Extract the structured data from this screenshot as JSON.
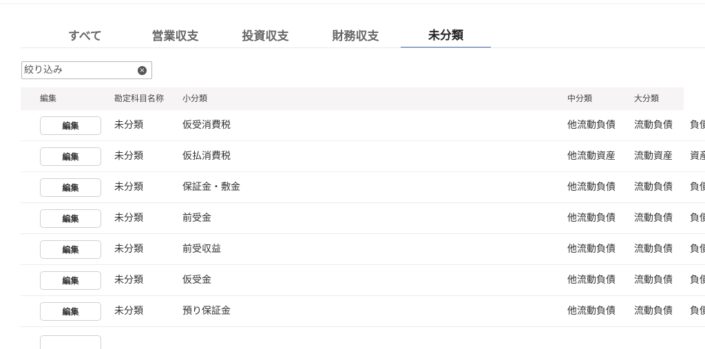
{
  "tabs": [
    {
      "label": "すべて"
    },
    {
      "label": "営業収支"
    },
    {
      "label": "投資収支"
    },
    {
      "label": "財務収支"
    },
    {
      "label": "未分類",
      "active": true
    }
  ],
  "filter": {
    "placeholder": "絞り込み",
    "value": ""
  },
  "columns": {
    "edit": "編集",
    "account_name": "勘定科目名称",
    "small_category": "小分類",
    "mid_category": "中分類",
    "large_category": "大分類"
  },
  "rows": [
    {
      "edit_label": "編集",
      "account": "未分類",
      "small": "仮受消費税",
      "mid": "他流動負債",
      "large": "流動負債",
      "extra": "負債"
    },
    {
      "edit_label": "編集",
      "account": "未分類",
      "small": "仮払消費税",
      "mid": "他流動資産",
      "large": "流動資産",
      "extra": "資産"
    },
    {
      "edit_label": "編集",
      "account": "未分類",
      "small": "保証金・敷金",
      "mid": "他流動負債",
      "large": "流動負債",
      "extra": "負債"
    },
    {
      "edit_label": "編集",
      "account": "未分類",
      "small": "前受金",
      "mid": "他流動負債",
      "large": "流動負債",
      "extra": "負債"
    },
    {
      "edit_label": "編集",
      "account": "未分類",
      "small": "前受収益",
      "mid": "他流動負債",
      "large": "流動負債",
      "extra": "負債"
    },
    {
      "edit_label": "編集",
      "account": "未分類",
      "small": "仮受金",
      "mid": "他流動負債",
      "large": "流動負債",
      "extra": "負債"
    },
    {
      "edit_label": "編集",
      "account": "未分類",
      "small": "預り保証金",
      "mid": "他流動負債",
      "large": "流動負債",
      "extra": "負債"
    }
  ],
  "icons": {
    "clear": "clear-circle-x-icon"
  },
  "colors": {
    "active_tab_underline": "#3b6fd9",
    "header_bg": "#f6f4f4"
  }
}
